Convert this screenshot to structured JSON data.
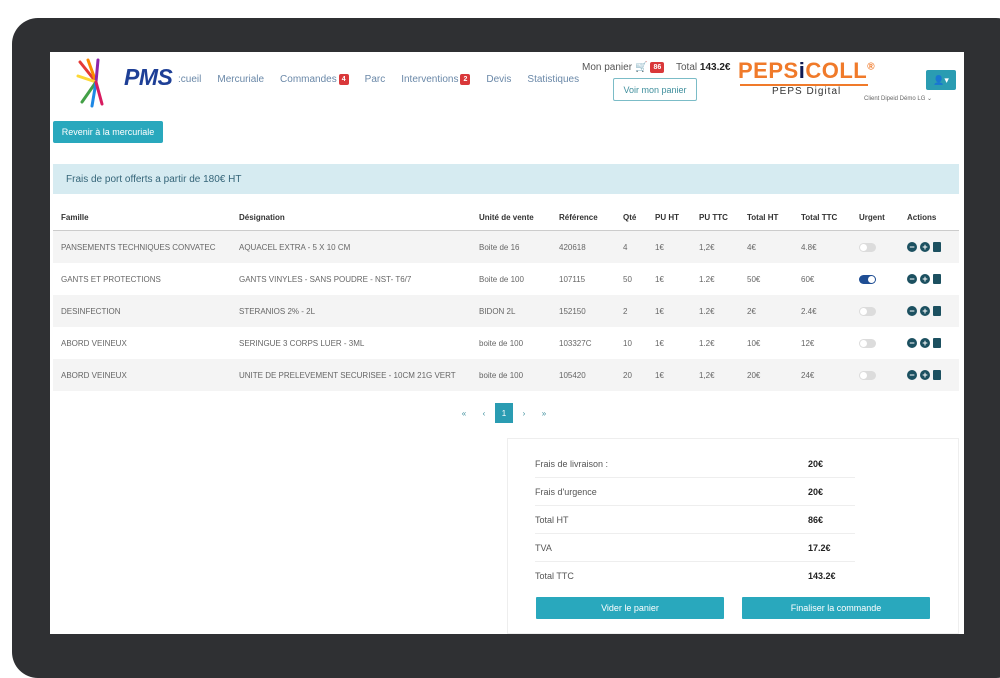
{
  "logo": {
    "text": "PMS"
  },
  "nav": {
    "items": [
      {
        "label": ":cueil",
        "badge": ""
      },
      {
        "label": "Mercuriale",
        "badge": ""
      },
      {
        "label": "Commandes",
        "badge": "4"
      },
      {
        "label": "Parc",
        "badge": ""
      },
      {
        "label": "Interventions",
        "badge": "2"
      },
      {
        "label": "Devis",
        "badge": ""
      },
      {
        "label": "Statistiques",
        "badge": ""
      }
    ]
  },
  "cart": {
    "label": "Mon panier",
    "badge": "86",
    "total_label": "Total",
    "total_value": "143.2€",
    "view_button": "Voir mon panier"
  },
  "brand": {
    "main_left": "PEPS",
    "main_i": "i",
    "main_right": "COLL",
    "reg": "®",
    "sub": "PEPS Digital"
  },
  "user": {
    "client": "Client Dipeid Démo LG"
  },
  "back_button": "Revenir à la mercuriale",
  "alert": "Frais de port offerts a partir de 180€ HT",
  "table": {
    "headers": [
      "Famille",
      "Désignation",
      "Unité de vente",
      "Référence",
      "Qté",
      "PU HT",
      "PU TTC",
      "Total HT",
      "Total TTC",
      "Urgent",
      "Actions"
    ],
    "rows": [
      {
        "famille": "PANSEMENTS TECHNIQUES CONVATEC",
        "designation": "AQUACEL EXTRA - 5 X 10 CM",
        "unite": "Boite de 16",
        "reference": "420618",
        "qte": "4",
        "pu_ht": "1€",
        "pu_ttc": "1,2€",
        "total_ht": "4€",
        "total_ttc": "4.8€",
        "urgent": false
      },
      {
        "famille": "GANTS ET PROTECTIONS",
        "designation": "GANTS VINYLES - SANS POUDRE - NST- T6/7",
        "unite": "Boite de 100",
        "reference": "107115",
        "qte": "50",
        "pu_ht": "1€",
        "pu_ttc": "1.2€",
        "total_ht": "50€",
        "total_ttc": "60€",
        "urgent": true
      },
      {
        "famille": "DESINFECTION",
        "designation": "STERANIOS 2% - 2L",
        "unite": "BIDON 2L",
        "reference": "152150",
        "qte": "2",
        "pu_ht": "1€",
        "pu_ttc": "1.2€",
        "total_ht": "2€",
        "total_ttc": "2.4€",
        "urgent": false
      },
      {
        "famille": "ABORD VEINEUX",
        "designation": "SERINGUE 3 CORPS LUER - 3ML",
        "unite": "boite de 100",
        "reference": "103327C",
        "qte": "10",
        "pu_ht": "1€",
        "pu_ttc": "1.2€",
        "total_ht": "10€",
        "total_ttc": "12€",
        "urgent": false
      },
      {
        "famille": "ABORD VEINEUX",
        "designation": "UNITE DE PRELEVEMENT SECURISEE - 10CM 21G VERT",
        "unite": "boite de 100",
        "reference": "105420",
        "qte": "20",
        "pu_ht": "1€",
        "pu_ttc": "1,2€",
        "total_ht": "20€",
        "total_ttc": "24€",
        "urgent": false
      }
    ]
  },
  "pagination": {
    "first": "«",
    "prev": "‹",
    "current": "1",
    "next": "›",
    "last": "»"
  },
  "totals": {
    "delivery_label": "Frais de livraison :",
    "delivery_value": "20€",
    "urgent_label": "Frais d'urgence",
    "urgent_value": "20€",
    "ht_label": "Total HT",
    "ht_value": "86€",
    "tva_label": "TVA",
    "tva_value": "17.2€",
    "ttc_label": "Total TTC",
    "ttc_value": "143.2€",
    "empty_button": "Vider le panier",
    "final_button": "Finaliser la commande"
  },
  "colors": {
    "accent": "#29a8bd",
    "brand_orange": "#f07a2a",
    "badge_red": "#d9383a",
    "toggle_on": "#1f4e94"
  }
}
